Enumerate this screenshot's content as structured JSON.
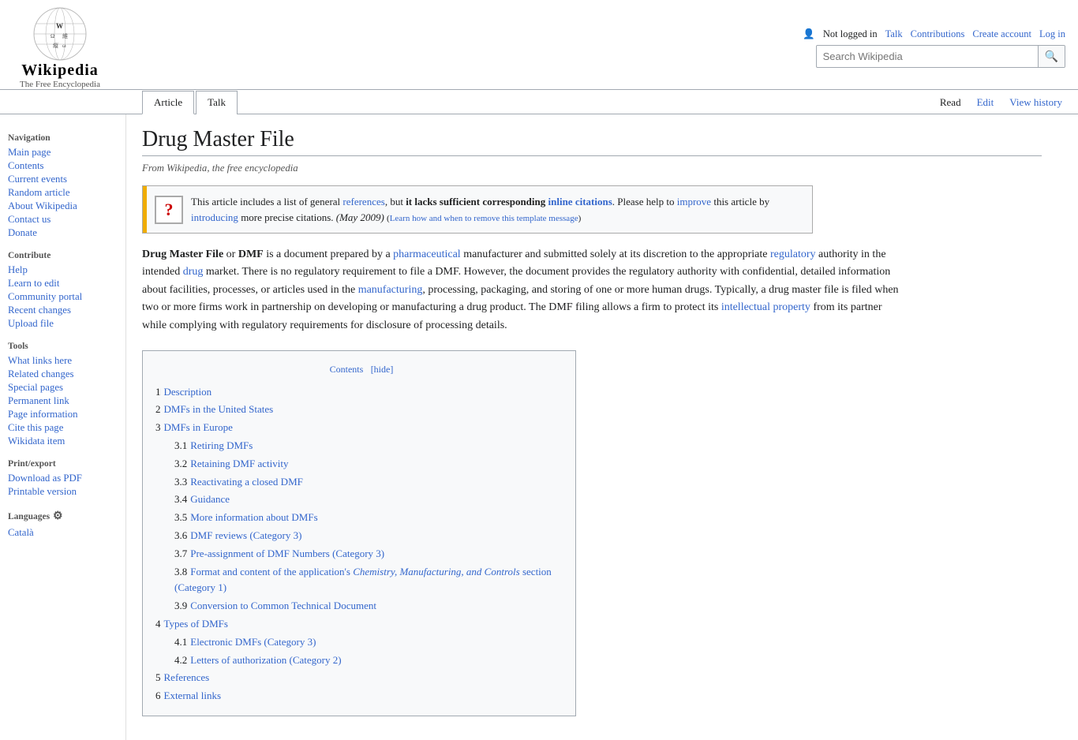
{
  "header": {
    "logo_title": "Wikipedia",
    "logo_subtitle": "The Free Encyclopedia",
    "user_bar": {
      "not_logged_in": "Not logged in",
      "talk": "Talk",
      "contributions": "Contributions",
      "create_account": "Create account",
      "log_in": "Log in"
    },
    "search_placeholder": "Search Wikipedia"
  },
  "tabs": {
    "article": "Article",
    "talk": "Talk",
    "read": "Read",
    "edit": "Edit",
    "view_history": "View history"
  },
  "sidebar": {
    "navigation_title": "Navigation",
    "nav_links": [
      {
        "label": "Main page",
        "name": "main-page"
      },
      {
        "label": "Contents",
        "name": "contents"
      },
      {
        "label": "Current events",
        "name": "current-events"
      },
      {
        "label": "Random article",
        "name": "random-article"
      },
      {
        "label": "About Wikipedia",
        "name": "about-wikipedia"
      },
      {
        "label": "Contact us",
        "name": "contact-us"
      },
      {
        "label": "Donate",
        "name": "donate"
      }
    ],
    "contribute_title": "Contribute",
    "contribute_links": [
      {
        "label": "Help",
        "name": "help"
      },
      {
        "label": "Learn to edit",
        "name": "learn-to-edit"
      },
      {
        "label": "Community portal",
        "name": "community-portal"
      },
      {
        "label": "Recent changes",
        "name": "recent-changes"
      },
      {
        "label": "Upload file",
        "name": "upload-file"
      }
    ],
    "tools_title": "Tools",
    "tools_links": [
      {
        "label": "What links here",
        "name": "what-links-here"
      },
      {
        "label": "Related changes",
        "name": "related-changes"
      },
      {
        "label": "Special pages",
        "name": "special-pages"
      },
      {
        "label": "Permanent link",
        "name": "permanent-link"
      },
      {
        "label": "Page information",
        "name": "page-information"
      },
      {
        "label": "Cite this page",
        "name": "cite-this-page"
      },
      {
        "label": "Wikidata item",
        "name": "wikidata-item"
      }
    ],
    "print_title": "Print/export",
    "print_links": [
      {
        "label": "Download as PDF",
        "name": "download-pdf"
      },
      {
        "label": "Printable version",
        "name": "printable-version"
      }
    ],
    "languages_title": "Languages",
    "language_links": [
      {
        "label": "Català",
        "name": "catala"
      }
    ]
  },
  "page": {
    "title": "Drug Master File",
    "subtitle": "From Wikipedia, the free encyclopedia",
    "notice": {
      "icon": "?",
      "text_start": "This article includes a list of general",
      "references": "references",
      "text_mid": ", but",
      "bold_text": "it lacks sufficient corresponding",
      "inline_citations": "inline citations",
      "text_end": ". Please help to",
      "improve": "improve",
      "text_end2": "this article by",
      "introducing": "introducing",
      "text_end3": "more precise citations.",
      "date": "(May 2009)",
      "learn": "Learn how and when to remove this template message"
    },
    "intro": {
      "bold": "Drug Master File",
      "or_dmf": " or ",
      "dmf": "DMF",
      "rest": " is a document prepared by a ",
      "pharmaceutical": "pharmaceutical",
      "rest2": " manufacturer and submitted solely at its discretion to the appropriate ",
      "regulatory": "regulatory",
      "rest3": " authority in the intended ",
      "drug": "drug",
      "rest4": " market. There is no regulatory requirement to file a DMF. However, the document provides the regulatory authority with confidential, detailed information about facilities, processes, or articles used in the ",
      "manufacturing": "manufacturing",
      "rest5": ", processing, packaging, and storing of one or more human drugs. Typically, a drug master file is filed when two or more firms work in partnership on developing or manufacturing a drug product. The DMF filing allows a firm to protect its ",
      "intellectual_property": "intellectual property",
      "rest6": " from its partner while complying with regulatory requirements for disclosure of processing details."
    },
    "toc": {
      "header": "Contents",
      "hide_label": "hide",
      "items": [
        {
          "num": "1",
          "label": "Description",
          "name": "description"
        },
        {
          "num": "2",
          "label": "DMFs in the United States",
          "name": "dmfs-us"
        },
        {
          "num": "3",
          "label": "DMFs in Europe",
          "name": "dmfs-europe"
        },
        {
          "num": "3.1",
          "label": "Retiring DMFs",
          "name": "retiring-dmfs"
        },
        {
          "num": "3.2",
          "label": "Retaining DMF activity",
          "name": "retaining-dmf"
        },
        {
          "num": "3.3",
          "label": "Reactivating a closed DMF",
          "name": "reactivating-dmf"
        },
        {
          "num": "3.4",
          "label": "Guidance",
          "name": "guidance"
        },
        {
          "num": "3.5",
          "label": "More information about DMFs",
          "name": "more-info-dmfs"
        },
        {
          "num": "3.6",
          "label": "DMF reviews (Category 3)",
          "name": "dmf-reviews"
        },
        {
          "num": "3.7",
          "label": "Pre-assignment of DMF Numbers (Category 3)",
          "name": "pre-assignment"
        },
        {
          "num": "3.8",
          "label": "Format and content of the application's Chemistry, Manufacturing, and Controls section (Category 1)",
          "name": "format-content",
          "italic_part": "Chemistry, Manufacturing, and Controls"
        },
        {
          "num": "3.9",
          "label": "Conversion to Common Technical Document",
          "name": "conversion"
        },
        {
          "num": "4",
          "label": "Types of DMFs",
          "name": "types-dmfs"
        },
        {
          "num": "4.1",
          "label": "Electronic DMFs (Category 3)",
          "name": "electronic-dmfs"
        },
        {
          "num": "4.2",
          "label": "Letters of authorization (Category 2)",
          "name": "letters-auth"
        },
        {
          "num": "5",
          "label": "References",
          "name": "references"
        },
        {
          "num": "6",
          "label": "External links",
          "name": "external-links"
        }
      ]
    }
  }
}
